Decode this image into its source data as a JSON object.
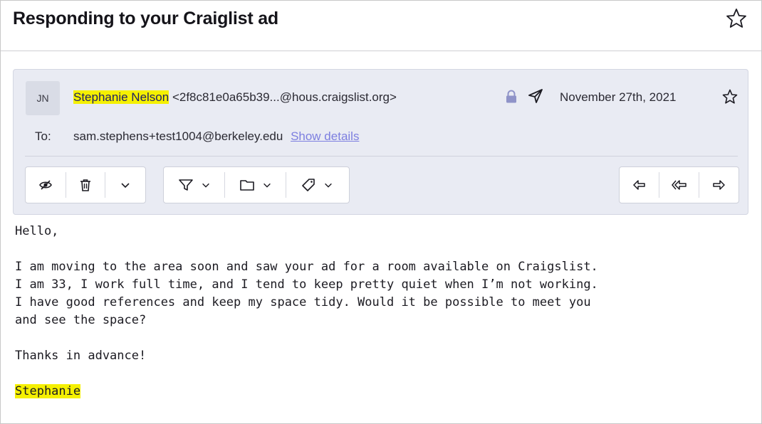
{
  "subject": "Responding to your Craiglist ad",
  "header": {
    "avatar_initials": "JN",
    "sender_name": "Stephanie Nelson",
    "sender_address": "<2f8c81e0a65b39...@hous.craigslist.org>",
    "date": "November 27th, 2021",
    "to_label": "To:",
    "to_value": "sam.stephens+test1004@berkeley.edu",
    "show_details": "Show details"
  },
  "toolbar": {
    "left_group": [
      "hide-icon",
      "trash-icon",
      "chevron-down-icon"
    ],
    "middle_group": [
      "filter-icon",
      "chevron-down-icon",
      "folder-icon",
      "chevron-down-icon",
      "tag-icon",
      "chevron-down-icon"
    ],
    "right_group": [
      "reply-icon",
      "reply-all-icon",
      "forward-icon"
    ]
  },
  "body": {
    "greeting": "Hello,",
    "paragraph_lines": [
      "I am moving to the area soon and saw your ad for a room available on Craigslist.",
      "I am 33, I work full time, and I tend to keep pretty quiet when I’m not working.",
      "I have good references and keep my space tidy. Would it be possible to meet you",
      "and see the space?"
    ],
    "thanks": "Thanks in advance!",
    "signature": "Stephanie"
  },
  "colors": {
    "highlight": "#f5f000",
    "header_bg": "#e9ebf3",
    "link": "#7d7fe0"
  }
}
